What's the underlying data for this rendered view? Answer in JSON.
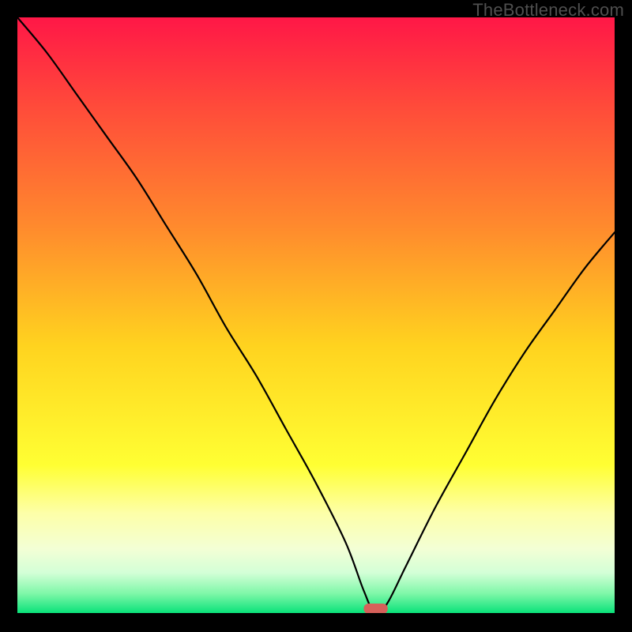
{
  "attribution": "TheBottleneck.com",
  "chart_data": {
    "type": "line",
    "title": "",
    "xlabel": "",
    "ylabel": "",
    "xlim": [
      0,
      100
    ],
    "ylim": [
      0,
      100
    ],
    "x": [
      0,
      5,
      10,
      15,
      20,
      25,
      30,
      35,
      40,
      45,
      50,
      55,
      58,
      60,
      62,
      65,
      70,
      75,
      80,
      85,
      90,
      95,
      100
    ],
    "values": [
      100,
      94,
      87,
      80,
      73,
      65,
      57,
      48,
      40,
      31,
      22,
      12,
      4,
      0,
      2,
      8,
      18,
      27,
      36,
      44,
      51,
      58,
      64
    ],
    "minimum_marker": {
      "x_start": 58,
      "x_end": 62,
      "color": "#d6605a"
    },
    "gradient_stops": [
      {
        "offset": 0.0,
        "color": "#ff1747"
      },
      {
        "offset": 0.15,
        "color": "#ff4b3a"
      },
      {
        "offset": 0.35,
        "color": "#ff8a2d"
      },
      {
        "offset": 0.55,
        "color": "#ffd31f"
      },
      {
        "offset": 0.75,
        "color": "#ffff33"
      },
      {
        "offset": 0.83,
        "color": "#fdffa8"
      },
      {
        "offset": 0.89,
        "color": "#f3ffd5"
      },
      {
        "offset": 0.93,
        "color": "#d3ffd7"
      },
      {
        "offset": 0.965,
        "color": "#7ef7a8"
      },
      {
        "offset": 1.0,
        "color": "#00e076"
      }
    ]
  }
}
